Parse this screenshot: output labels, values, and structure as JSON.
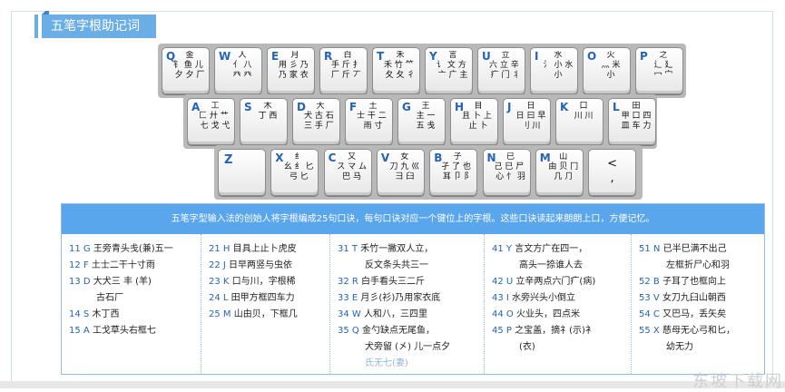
{
  "header": {
    "title": "五笔字根助记词"
  },
  "keyboard": {
    "row1": [
      {
        "letter": "Q",
        "glyph": "金\n钅 鱼 儿 勹\n夕 夕 厂"
      },
      {
        "letter": "W",
        "glyph": "人\n亻 八\n癶 癶"
      },
      {
        "letter": "E",
        "glyph": "月\n用 彡 乃 豕\n乃 家 衣 豕"
      },
      {
        "letter": "R",
        "glyph": "白\n手 斤 扌 斤\n厂 斤 丆 斤"
      },
      {
        "letter": "T",
        "glyph": "禾\n禾 竹 ⺮ 丿\n夂 夂 彳"
      },
      {
        "letter": "Y",
        "glyph": "言\n讠 文 方 丶\n亠 广 主"
      },
      {
        "letter": "U",
        "glyph": "立\n六 立 辛 丷\n疒 门 丬"
      },
      {
        "letter": "I",
        "glyph": "水\n氵 小 水\n小"
      },
      {
        "letter": "O",
        "glyph": "火\n灬 米\n小"
      },
      {
        "letter": "P",
        "glyph": "之\n辶 廴\n冖 宀"
      }
    ],
    "row2": [
      {
        "letter": "A",
        "glyph": "工\n匚 廾 艹 廿\n七 戈 弋"
      },
      {
        "letter": "S",
        "glyph": "木\n丁 西"
      },
      {
        "letter": "D",
        "glyph": "大\n犬 古 石 三\n三 手 厂 丆"
      },
      {
        "letter": "F",
        "glyph": "土\n士 干 二 十\n雨 寸"
      },
      {
        "letter": "G",
        "glyph": "王\n主 一\n五 戋"
      },
      {
        "letter": "H",
        "glyph": "目\n且 卜 上 丨\n止 卜"
      },
      {
        "letter": "J",
        "glyph": "日\n日 曰 早\n刂 川"
      },
      {
        "letter": "K",
        "glyph": "口\n川 川"
      },
      {
        "letter": "L",
        "glyph": "田\n甲 口 四\n皿 车 力"
      }
    ],
    "row3": [
      {
        "letter": "Z",
        "glyph": ""
      },
      {
        "letter": "X",
        "glyph": "纟\n幺 纟 匕\n弓 匕"
      },
      {
        "letter": "C",
        "glyph": "又\nス マ ム\n巴 马"
      },
      {
        "letter": "V",
        "glyph": "女\n刀 九 巛\n彐 臼"
      },
      {
        "letter": "B",
        "glyph": "子\n孑 了 也 凵\n耳 卩 阝"
      },
      {
        "letter": "N",
        "glyph": "已\n己 巳 尸 乙\n心 忄 羽"
      },
      {
        "letter": "M",
        "glyph": "山\n由 贝 冂\n几 ⺆"
      },
      {
        "letter": "",
        "glyph": "<\n,"
      }
    ]
  },
  "description": {
    "headline": "五笔字型输入法的创始人将字根编成25句口诀，每句口诀对应一个键位上的字根。这些口诀读起来朗朗上口，方便记忆。",
    "columns": [
      [
        {
          "num": "11 G",
          "text": "王旁青头戋(兼)五一"
        },
        {
          "num": "12 F",
          "text": "土士二干十寸雨"
        },
        {
          "num": "13 D",
          "text": "大犬三 丰 (羊)"
        },
        {
          "num": "",
          "text": "古石厂"
        },
        {
          "num": "14 S",
          "text": "木丁西"
        },
        {
          "num": "15 A",
          "text": "工戈草头右框七"
        }
      ],
      [
        {
          "num": "21 H",
          "text": "目具上止卜虎皮"
        },
        {
          "num": "22 J",
          "text": "日早两竖与虫依"
        },
        {
          "num": "23 K",
          "text": "口与川，字根稀"
        },
        {
          "num": "24 L",
          "text": "田甲方框四车力"
        },
        {
          "num": "25 M",
          "text": "山由贝，下框几"
        }
      ],
      [
        {
          "num": "31 T",
          "text": "禾竹一撇双人立，"
        },
        {
          "num": "",
          "text": "反文条头共三一"
        },
        {
          "num": "32 R",
          "text": "白手看头三二斤"
        },
        {
          "num": "33 E",
          "text": "月彡(衫)乃用家衣底"
        },
        {
          "num": "34 W",
          "text": "人和八，三四里"
        },
        {
          "num": "35 Q",
          "text": "金勺缺点无尾鱼，"
        },
        {
          "num": "",
          "text": "犬旁留 (㐅) 儿一点夕"
        },
        {
          "num": "",
          "text": "氏无七(妻)"
        }
      ],
      [
        {
          "num": "41 Y",
          "text": "言文方广在四一，"
        },
        {
          "num": "",
          "text": "高头一捺谁人去"
        },
        {
          "num": "42 U",
          "text": "立辛两点六门疒(病)"
        },
        {
          "num": "43 I",
          "text": "水旁兴头小倒立"
        },
        {
          "num": "44 O",
          "text": "火业头，四点米"
        },
        {
          "num": "45 P",
          "text": "之宝盖，摘礻(示)衤"
        },
        {
          "num": "",
          "text": "(衣)"
        }
      ],
      [
        {
          "num": "51 N",
          "text": "已半巳满不出己"
        },
        {
          "num": "",
          "text": "左框折尸心和羽"
        },
        {
          "num": "52 B",
          "text": "子耳了也框向上"
        },
        {
          "num": "53 V",
          "text": "女刀九臼山朝西"
        },
        {
          "num": "54 C",
          "text": "又巴马，丢矢矣"
        },
        {
          "num": "55 X",
          "text": "慈母无心弓和匕，"
        },
        {
          "num": "",
          "text": "幼无力"
        }
      ]
    ]
  },
  "watermark": "东坡下载网"
}
